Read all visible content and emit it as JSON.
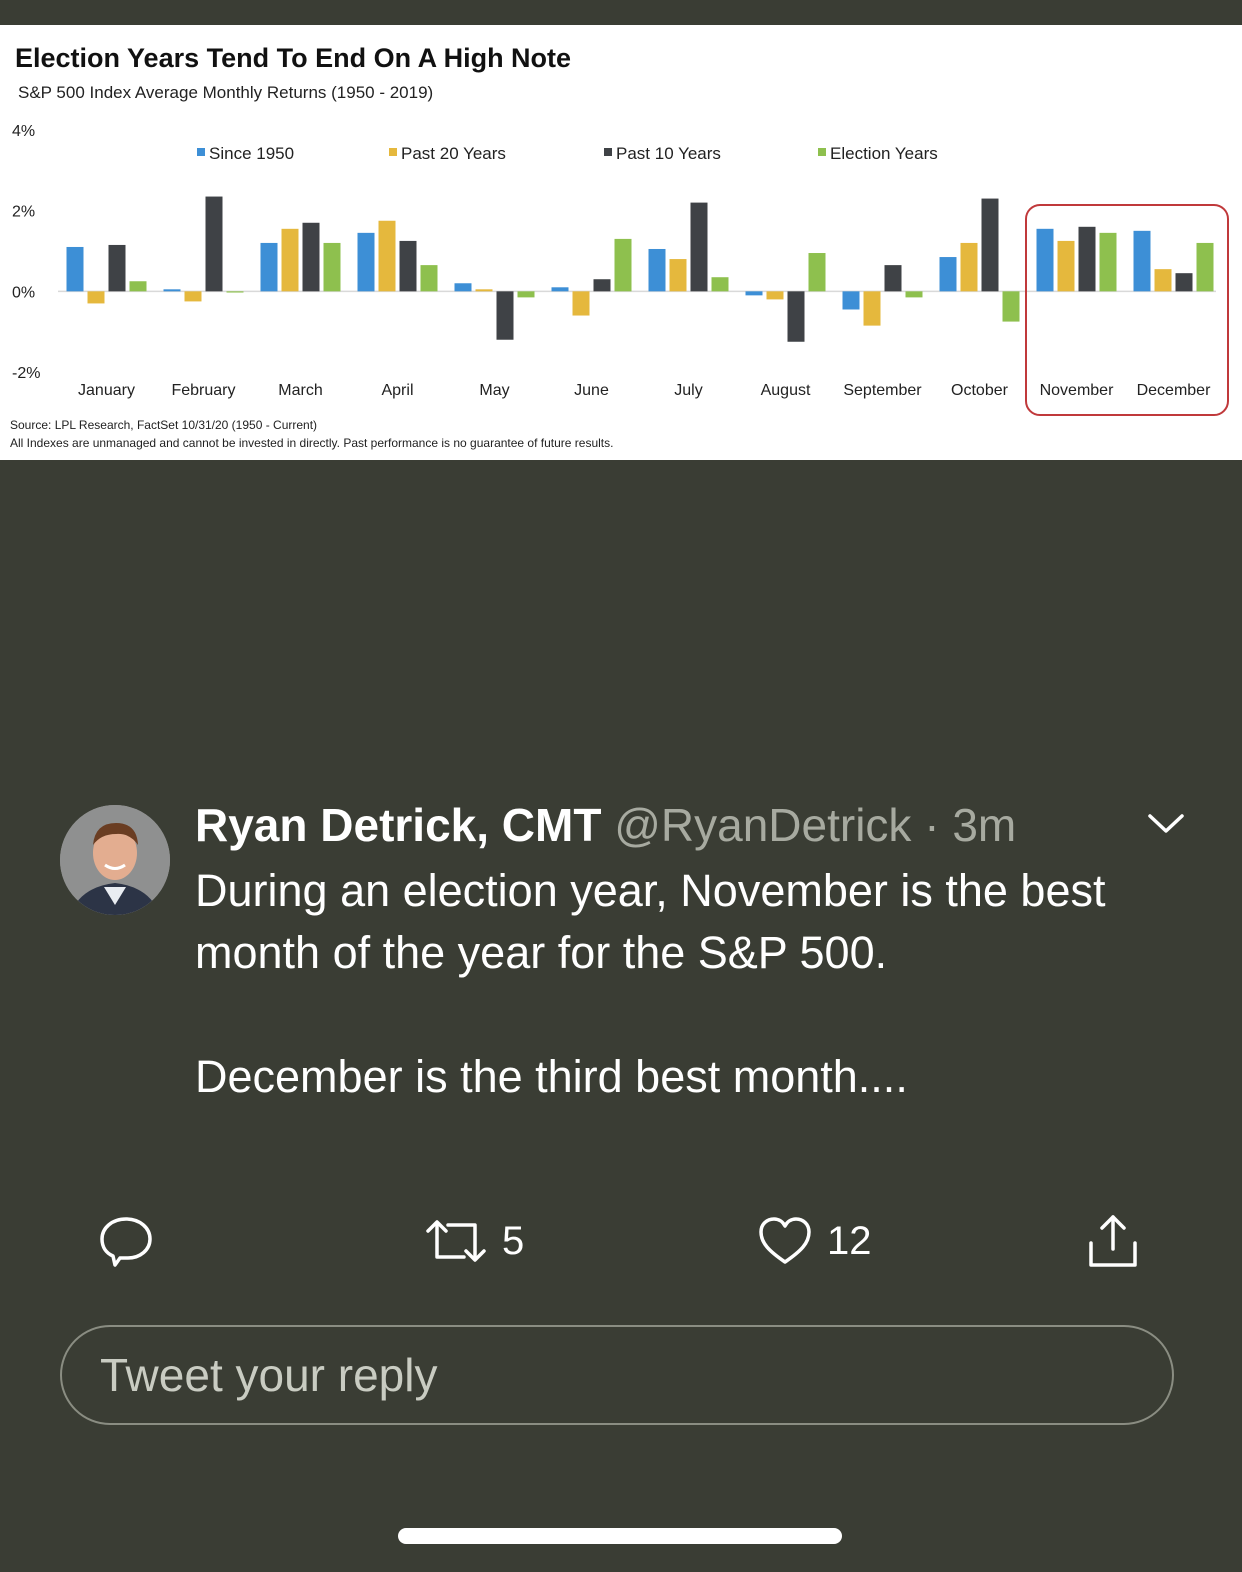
{
  "chart_data": {
    "type": "bar",
    "title": "Election Years Tend To End On A High Note",
    "subtitle": "S&P 500 Index Average Monthly Returns (1950 - 2019)",
    "categories": [
      "January",
      "February",
      "March",
      "April",
      "May",
      "June",
      "July",
      "August",
      "September",
      "October",
      "November",
      "December"
    ],
    "series": [
      {
        "name": "Since 1950",
        "color": "#3d8fd6",
        "values": [
          1.1,
          0.05,
          1.2,
          1.45,
          0.2,
          0.1,
          1.05,
          -0.1,
          -0.45,
          0.85,
          1.55,
          1.5
        ]
      },
      {
        "name": "Past 20 Years",
        "color": "#e5b83d",
        "values": [
          -0.3,
          -0.25,
          1.55,
          1.75,
          0.05,
          -0.6,
          0.8,
          -0.2,
          -0.85,
          1.2,
          1.25,
          0.55
        ]
      },
      {
        "name": "Past 10 Years",
        "color": "#3f4246",
        "values": [
          1.15,
          2.35,
          1.7,
          1.25,
          -1.2,
          0.3,
          2.2,
          -1.25,
          0.65,
          2.3,
          1.6,
          0.45
        ]
      },
      {
        "name": "Election Years",
        "color": "#8ec04e",
        "values": [
          0.25,
          0.0,
          1.2,
          0.65,
          -0.15,
          1.3,
          0.35,
          0.95,
          -0.15,
          -0.75,
          1.45,
          1.2
        ]
      }
    ],
    "ylim": [
      -2,
      4
    ],
    "y_ticks": [
      "4%",
      "2%",
      "0%",
      "-2%"
    ],
    "legend_position": "top",
    "highlight": [
      "November",
      "December"
    ],
    "highlight_color": "#c0393b",
    "source": "Source: LPL Research, FactSet 10/31/20 (1950 - Current)",
    "disclaimer": "All Indexes are unmanaged and cannot be invested in directly. Past performance is no guarantee of future results."
  },
  "tweet": {
    "author_name": "Ryan Detrick, CMT",
    "handle": "@RyanDetrick",
    "separator": "·",
    "time": "3m",
    "body": [
      "During an election year, November is the best month of the year for the S&P 500.",
      "December is the third best month...."
    ],
    "menu_icon": "chevron-down-icon",
    "actions": {
      "reply_icon": "reply-icon",
      "retweet_icon": "retweet-icon",
      "retweet_count": "5",
      "like_icon": "heart-icon",
      "like_count": "12",
      "share_icon": "share-icon"
    }
  },
  "reply": {
    "placeholder": "Tweet your reply"
  },
  "colors": {
    "background": "#3a3d34",
    "text": "#ffffff",
    "muted": "#a7aaa0"
  }
}
